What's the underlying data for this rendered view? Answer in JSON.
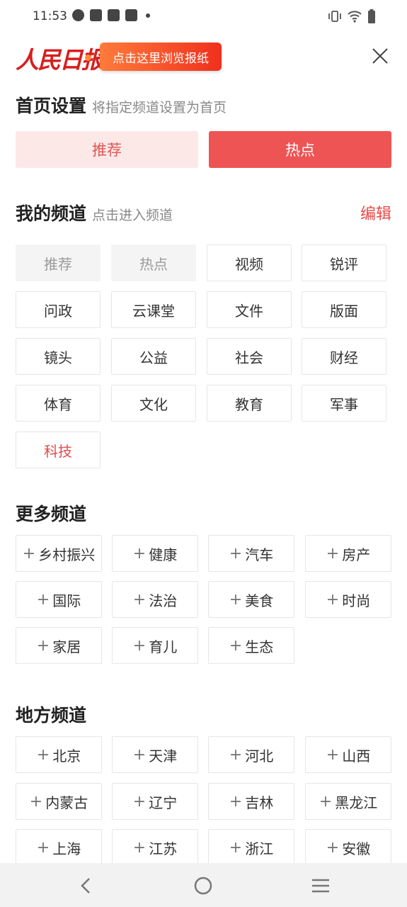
{
  "status_bar": {
    "time": "11:53",
    "icons_left": [
      "speedometer-icon",
      "bag-icon",
      "bag-icon",
      "bag-icon",
      "dot-icon"
    ],
    "icons_right": [
      "vibrate-icon",
      "wifi-icon",
      "battery-icon"
    ]
  },
  "header": {
    "logo_text": "人民日报",
    "paper_button": "点击这里浏览报纸",
    "close_icon": "close-icon",
    "accent_color": "#ee5454"
  },
  "home_setting": {
    "title": "首页设置",
    "subtitle": "将指定频道设置为首页",
    "options": [
      "推荐",
      "热点"
    ],
    "selected": "热点"
  },
  "my_channels": {
    "title": "我的频道",
    "subtitle": "点击进入频道",
    "edit_label": "编辑",
    "items": [
      "推荐",
      "热点",
      "视频",
      "锐评",
      "问政",
      "云课堂",
      "文件",
      "版面",
      "镜头",
      "公益",
      "社会",
      "财经",
      "体育",
      "文化",
      "教育",
      "军事",
      "科技"
    ]
  },
  "more_channels": {
    "title": "更多频道",
    "items": [
      "乡村振兴",
      "健康",
      "汽车",
      "房产",
      "国际",
      "法治",
      "美食",
      "时尚",
      "家居",
      "育儿",
      "生态"
    ]
  },
  "local_channels": {
    "title": "地方频道",
    "items": [
      "北京",
      "天津",
      "河北",
      "山西",
      "内蒙古",
      "辽宁",
      "吉林",
      "黑龙江",
      "上海",
      "江苏",
      "浙江",
      "安徽"
    ]
  },
  "nav_bar": {
    "icons": [
      "back-icon",
      "home-icon",
      "menu-icon"
    ]
  }
}
